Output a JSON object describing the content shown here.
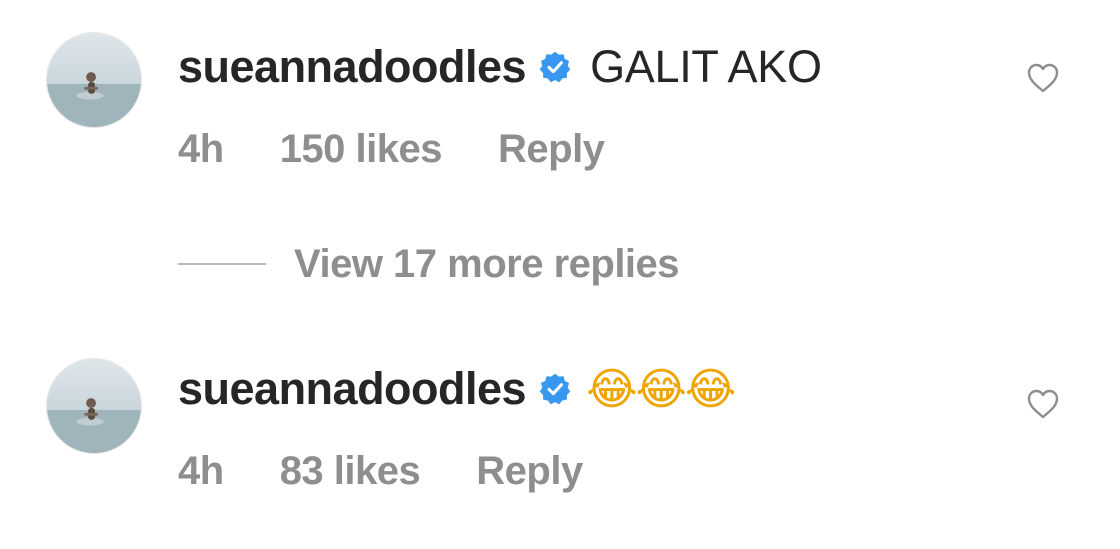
{
  "colors": {
    "text_primary": "#262626",
    "text_secondary": "#8e8e8e",
    "verified_blue": "#3897f0",
    "divider": "#b9b9b9"
  },
  "comments": [
    {
      "avatar_icon": "avatar-photo",
      "username": "sueannadoodles",
      "verified_icon": "verified-badge-icon",
      "text": "GALIT AKO",
      "time": "4h",
      "likes": "150 likes",
      "reply_label": "Reply",
      "like_icon": "heart-outline-icon"
    },
    {
      "avatar_icon": "avatar-photo",
      "username": "sueannadoodles",
      "verified_icon": "verified-badge-icon",
      "text": "😂😂😂",
      "time": "4h",
      "likes": "83 likes",
      "reply_label": "Reply",
      "like_icon": "heart-outline-icon"
    }
  ],
  "view_replies": {
    "label": "View 17 more replies"
  }
}
